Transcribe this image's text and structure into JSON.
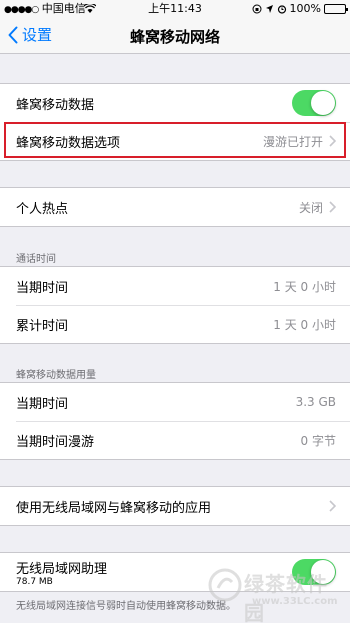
{
  "status": {
    "carrier": "中国电信",
    "time": "上午11:43",
    "battery": "100%"
  },
  "nav": {
    "back_label": "设置",
    "title": "蜂窝移动网络"
  },
  "cellular": {
    "data_label": "蜂窝移动数据",
    "data_on": true,
    "options_label": "蜂窝移动数据选项",
    "options_value": "漫游已打开"
  },
  "hotspot": {
    "label": "个人热点",
    "value": "关闭"
  },
  "call_time": {
    "header": "通话时间",
    "rows": [
      {
        "label": "当期时间",
        "value": "1 天 0 小时"
      },
      {
        "label": "累计时间",
        "value": "1 天 0 小时"
      }
    ]
  },
  "usage": {
    "header": "蜂窝移动数据用量",
    "rows": [
      {
        "label": "当期时间",
        "value": "3.3 GB"
      },
      {
        "label": "当期时间漫游",
        "value": "0 字节"
      }
    ]
  },
  "apps": {
    "label": "使用无线局域网与蜂窝移动的应用"
  },
  "wlan_assist": {
    "label": "无线局域网助理",
    "sub": "78.7 MB",
    "on": true,
    "footnote": "无线局域网连接信号弱时自动使用蜂窝移动数据。"
  },
  "watermark": {
    "title": "绿茶软件园",
    "url": "www.33LC.com"
  },
  "colors": {
    "accent": "#007aff",
    "toggle_on": "#4cd964",
    "highlight": "#d81e2a"
  }
}
